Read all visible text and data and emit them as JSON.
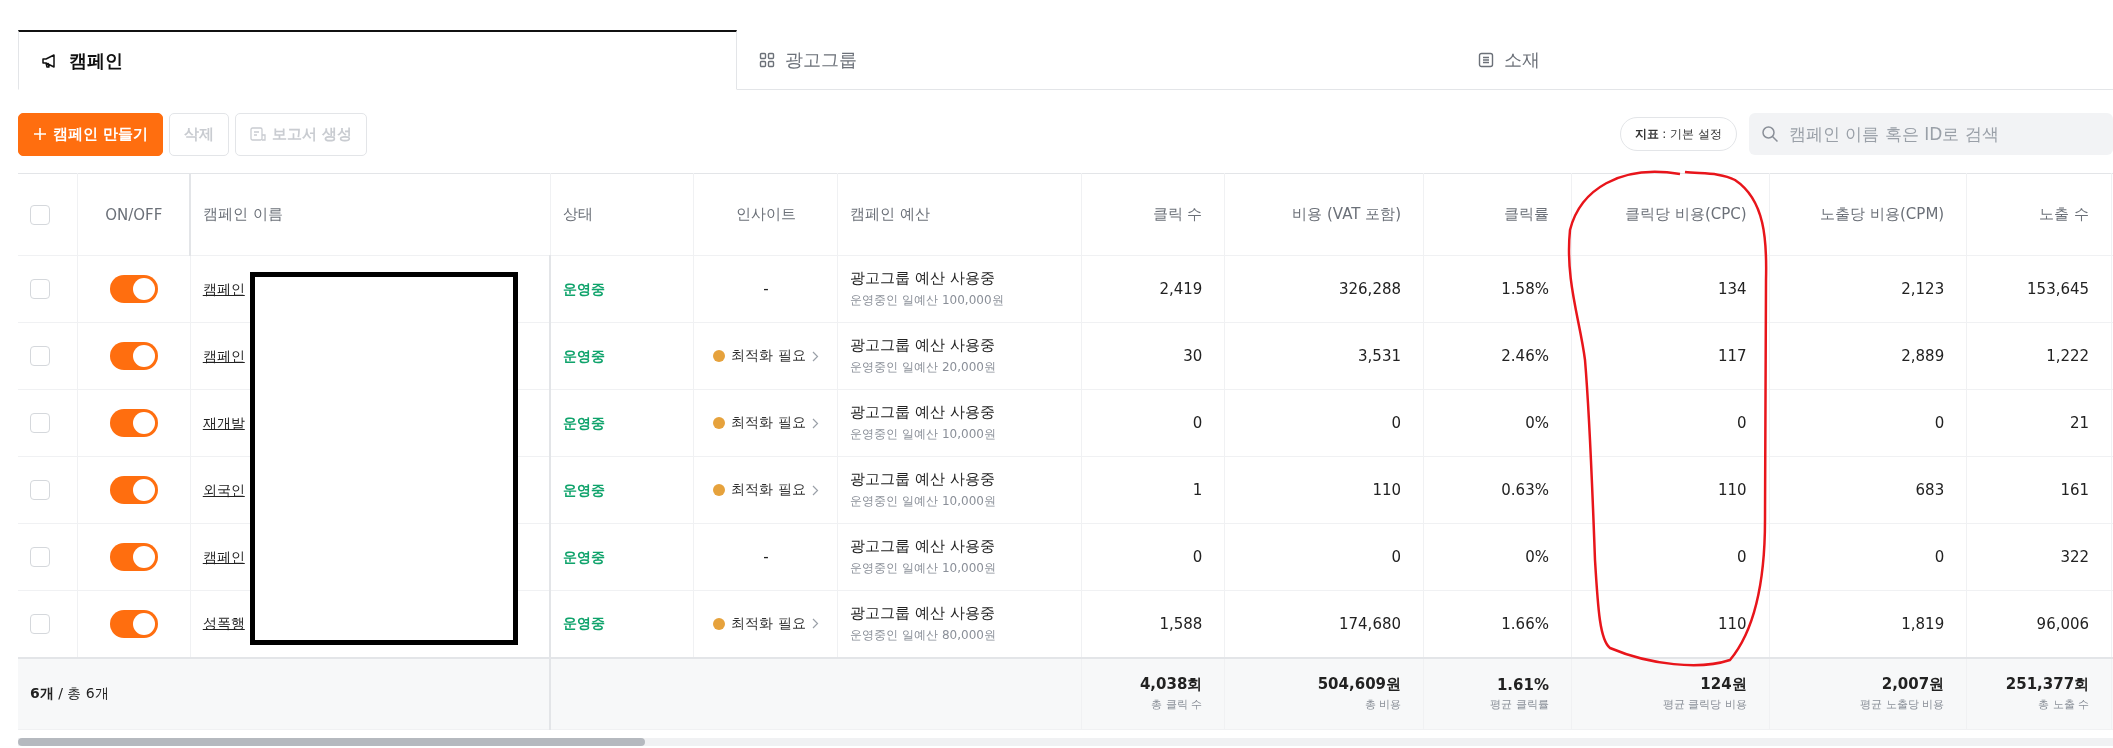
{
  "tabs": [
    {
      "label": "캠페인",
      "kind": "megaphone",
      "selected": true
    },
    {
      "label": "광고그룹",
      "kind": "grid",
      "selected": false
    },
    {
      "label": "소재",
      "kind": "list",
      "selected": false
    }
  ],
  "toolbar": {
    "buttons": [
      {
        "label": "캠페인 만들기",
        "kind": "primary",
        "disabled": false
      },
      {
        "label": "삭제",
        "kind": "plain",
        "disabled": true
      },
      {
        "label": "보고서 생성",
        "kind": "report",
        "disabled": true
      }
    ],
    "metric_setting": {
      "label": "지표",
      "value": ": 기본 설정"
    },
    "search": {
      "placeholder": "캠페인 이름 혹은 ID로 검색"
    }
  },
  "table": {
    "columns": [
      "ON/OFF",
      "캠페인 이름",
      "상태",
      "인사이트",
      "캠페인 예산",
      "클릭 수",
      "비용 (VAT 포함)",
      "클릭률",
      "클릭당 비용(CPC)",
      "노출당 비용(CPM)",
      "노출 수"
    ],
    "header_checked": false,
    "rows": [
      {
        "checked": false,
        "on": true,
        "name": "캠페인",
        "status": "운영중",
        "insight": {
          "kind": "none",
          "text": "-"
        },
        "budget": "광고그룹 예산 사용중",
        "budget_detail": "운영중인 일예산 100,000원",
        "clicks": "2,419",
        "cost": "326,288",
        "ctr": "1.58%",
        "cpc": "134",
        "cpm": "2,123",
        "impressions": "153,645"
      },
      {
        "checked": false,
        "on": true,
        "name": "캠페인",
        "status": "운영중",
        "insight": {
          "kind": "alert",
          "text": "최적화 필요"
        },
        "budget": "광고그룹 예산 사용중",
        "budget_detail": "운영중인 일예산 20,000원",
        "clicks": "30",
        "cost": "3,531",
        "ctr": "2.46%",
        "cpc": "117",
        "cpm": "2,889",
        "impressions": "1,222"
      },
      {
        "checked": false,
        "on": true,
        "name": "재개발",
        "status": "운영중",
        "insight": {
          "kind": "alert",
          "text": "최적화 필요"
        },
        "budget": "광고그룹 예산 사용중",
        "budget_detail": "운영중인 일예산 10,000원",
        "clicks": "0",
        "cost": "0",
        "ctr": "0%",
        "cpc": "0",
        "cpm": "0",
        "impressions": "21"
      },
      {
        "checked": false,
        "on": true,
        "name": "외국인",
        "status": "운영중",
        "insight": {
          "kind": "alert",
          "text": "최적화 필요"
        },
        "budget": "광고그룹 예산 사용중",
        "budget_detail": "운영중인 일예산 10,000원",
        "clicks": "1",
        "cost": "110",
        "ctr": "0.63%",
        "cpc": "110",
        "cpm": "683",
        "impressions": "161"
      },
      {
        "checked": false,
        "on": true,
        "name": "캠페인",
        "status": "운영중",
        "insight": {
          "kind": "none",
          "text": "-"
        },
        "budget": "광고그룹 예산 사용중",
        "budget_detail": "운영중인 일예산 10,000원",
        "clicks": "0",
        "cost": "0",
        "ctr": "0%",
        "cpc": "0",
        "cpm": "0",
        "impressions": "322"
      },
      {
        "checked": false,
        "on": true,
        "name": "성폭행",
        "status": "운영중",
        "insight": {
          "kind": "alert",
          "text": "최적화 필요"
        },
        "budget": "광고그룹 예산 사용중",
        "budget_detail": "운영중인 일예산 80,000원",
        "clicks": "1,588",
        "cost": "174,680",
        "ctr": "1.66%",
        "cpc": "110",
        "cpm": "1,819",
        "impressions": "96,006"
      }
    ],
    "footer": {
      "count": "6개",
      "total": "/ 총 6개",
      "totals": [
        {
          "value": "4,038회",
          "label": "총 클릭 수"
        },
        {
          "value": "504,609원",
          "label": "총 비용"
        },
        {
          "value": "1.61%",
          "label": "평균 클릭률"
        },
        {
          "value": "124원",
          "label": "평균 클릭당 비용"
        },
        {
          "value": "2,007원",
          "label": "평균 노출당 비용"
        },
        {
          "value": "251,377회",
          "label": "총 노출 수"
        }
      ]
    }
  },
  "overlays": {
    "redaction_box": true,
    "hand_drawn_circle": true
  }
}
